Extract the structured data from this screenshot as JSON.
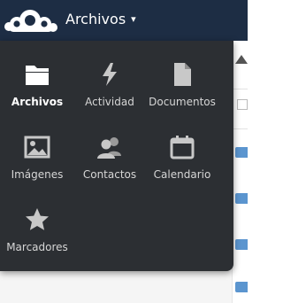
{
  "header": {
    "logo_icon": "cloud-logo-icon",
    "app_title": "Archivos",
    "caret": "▾",
    "background_color": "#1d2d44"
  },
  "app_menu": {
    "background_color": "#2c2f33",
    "active_item": "Archivos",
    "items": [
      {
        "label": "Archivos",
        "icon": "folder-icon"
      },
      {
        "label": "Actividad",
        "icon": "lightning-icon"
      },
      {
        "label": "Documentos",
        "icon": "document-icon"
      },
      {
        "label": "Imágenes",
        "icon": "image-icon"
      },
      {
        "label": "Contactos",
        "icon": "contacts-icon"
      },
      {
        "label": "Calendario",
        "icon": "calendar-icon"
      },
      {
        "label": "Marcadores",
        "icon": "star-icon"
      }
    ]
  }
}
